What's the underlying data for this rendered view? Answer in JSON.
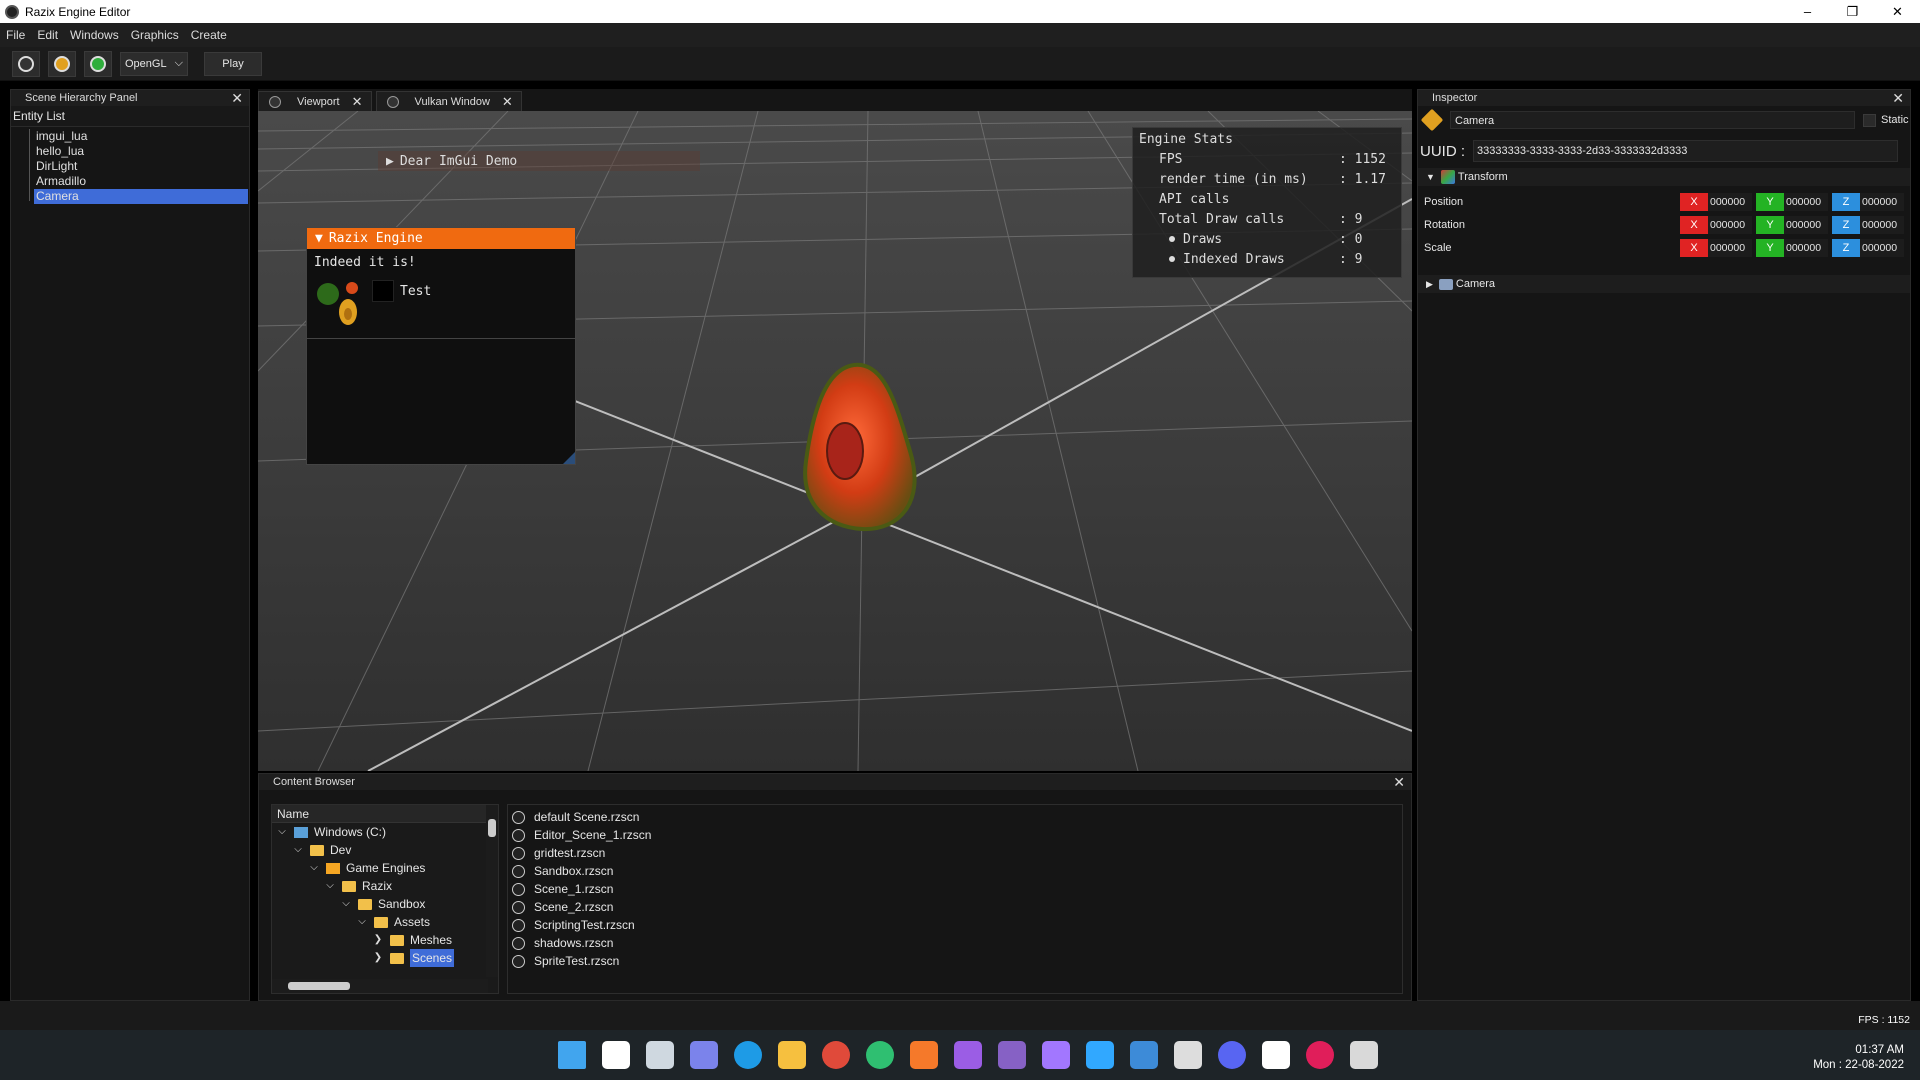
{
  "window": {
    "title": "Razix Engine Editor",
    "min": "–",
    "max": "❐",
    "close": "✕"
  },
  "menu": [
    "File",
    "Edit",
    "Windows",
    "Graphics",
    "Create"
  ],
  "toolbar": {
    "api": "OpenGL",
    "play": "Play",
    "combo_arrow": "⌵"
  },
  "hierarchy": {
    "title": "Scene Hierarchy Panel",
    "list_title": "Entity List",
    "entities": [
      "imgui_lua",
      "hello_lua",
      "DirLight",
      "Armadillo",
      "Camera"
    ],
    "selected": "Camera"
  },
  "tabs": [
    {
      "label": "Viewport",
      "close": "✕"
    },
    {
      "label": "Vulkan Window",
      "close": "✕"
    }
  ],
  "viewport": {
    "demo_window": "Dear ImGui Demo",
    "razix_window": {
      "title": "Razix Engine",
      "text": "Indeed it is!",
      "button": "Test"
    },
    "stats": {
      "title": "Engine Stats",
      "fps_label": "FPS",
      "fps": ": 1152",
      "render_label": "render time (in ms)",
      "render": ": 1.17",
      "api_label": "API calls",
      "draws_label": "Total Draw calls",
      "draws": ": 9",
      "simple_label": "Draws",
      "simple": ": 0",
      "indexed_label": "Indexed Draws",
      "indexed": ": 9"
    }
  },
  "content_browser": {
    "title": "Content Browser",
    "tree_header": "Name",
    "tree": [
      {
        "label": "Windows (C:)",
        "depth": 0,
        "kind": "drive"
      },
      {
        "label": "Dev",
        "depth": 1,
        "kind": "folder"
      },
      {
        "label": "Game Engines",
        "depth": 2,
        "kind": "engine"
      },
      {
        "label": "Razix",
        "depth": 3,
        "kind": "folder"
      },
      {
        "label": "Sandbox",
        "depth": 4,
        "kind": "folder"
      },
      {
        "label": "Assets",
        "depth": 5,
        "kind": "folder"
      },
      {
        "label": "Meshes",
        "depth": 6,
        "kind": "folder",
        "collapsed": true
      },
      {
        "label": "Scenes",
        "depth": 6,
        "kind": "folder",
        "collapsed": true,
        "selected": true
      }
    ],
    "files": [
      "default Scene.rzscn",
      "Editor_Scene_1.rzscn",
      "gridtest.rzscn",
      "Sandbox.rzscn",
      "Scene_1.rzscn",
      "Scene_2.rzscn",
      "ScriptingTest.rzscn",
      "shadows.rzscn",
      "SpriteTest.rzscn"
    ]
  },
  "inspector": {
    "title": "Inspector",
    "entity_name": "Camera",
    "static_label": "Static",
    "uuid_label": "UUID :",
    "uuid": "33333333-3333-3333-2d33-3333332d3333",
    "transform_label": "Transform",
    "rows": [
      {
        "label": "Position",
        "x": "000000",
        "y": "000000",
        "z": "000000"
      },
      {
        "label": "Rotation",
        "x": "000000",
        "y": "000000",
        "z": "000000"
      },
      {
        "label": "Scale",
        "x": "000000",
        "y": "000000",
        "z": "000000"
      }
    ],
    "axis": {
      "x": "X",
      "y": "Y",
      "z": "Z"
    },
    "camera_label": "Camera"
  },
  "status": {
    "fps": "FPS : 1152"
  },
  "taskbar": {
    "time": "01:37 AM",
    "date": "Mon : 22-08-2022",
    "apps": [
      "windows-start-icon",
      "search-icon",
      "task-view-icon",
      "chat-icon",
      "edge-icon",
      "file-explorer-icon",
      "chrome-icon",
      "app-green-icon",
      "blender-icon",
      "visual-studio-icon",
      "visual-studio-2-icon",
      "visual-studio-3-icon",
      "photoshop-icon",
      "notepad-icon",
      "unity-icon",
      "discord-icon",
      "notion-icon",
      "slack-icon",
      "razix-editor-taskbar-icon"
    ],
    "colors": [
      "#41a5ee",
      "#ffffff",
      "#cfd8e0",
      "#7b83eb",
      "#1e9be6",
      "#f6c03f",
      "#e04a3a",
      "#2fbf71",
      "#f5792a",
      "#9b5de5",
      "#8661c5",
      "#a277ff",
      "#31a8ff",
      "#3d8bd8",
      "#dddddd",
      "#5865f2",
      "#ffffff",
      "#e01e5a",
      "#d9d9d9"
    ]
  }
}
